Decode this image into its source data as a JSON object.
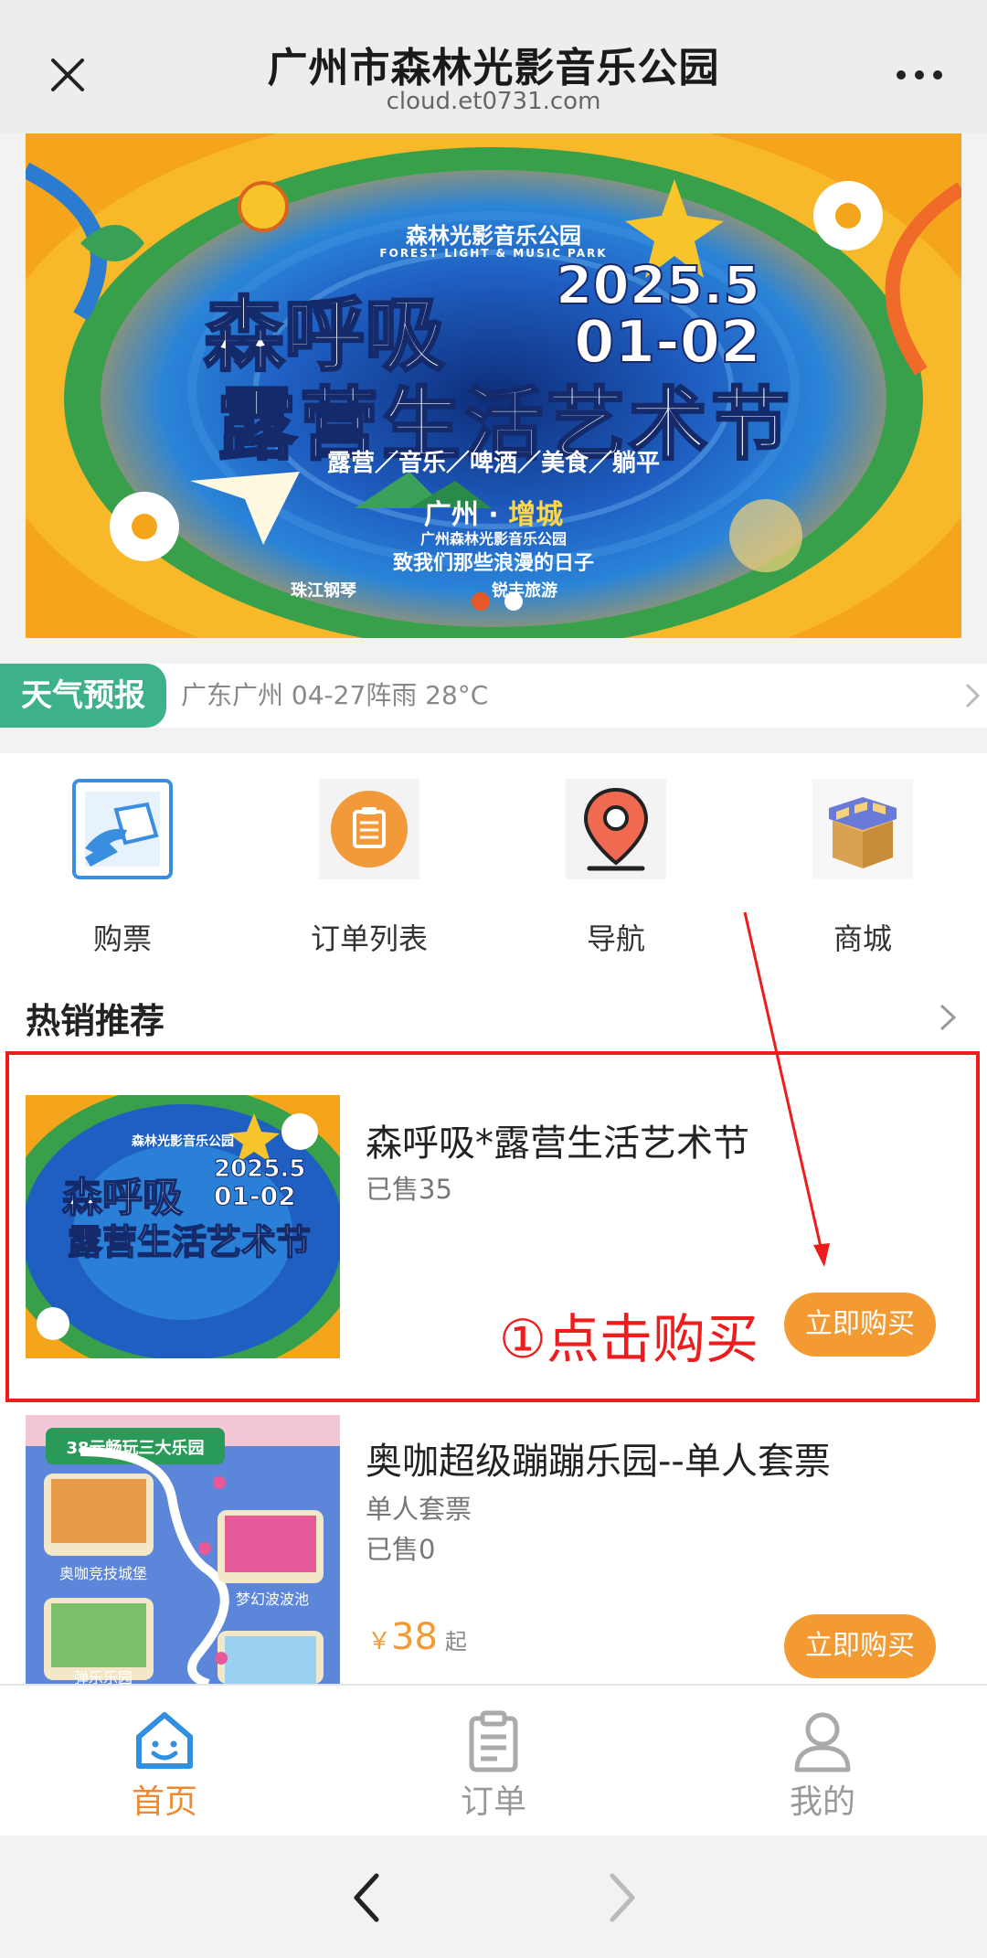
{
  "topbar": {
    "title": "广州市森林光影音乐公园",
    "subtitle": "cloud.et0731.com",
    "close_icon": "close-icon",
    "more_icon": "more-icon"
  },
  "banner": {
    "brand": "森林光影音乐公园",
    "brand_en": "FOREST LIGHT & MUSIC PARK",
    "date_line1": "2025.5",
    "date_line2": "01-02",
    "headline1": "森呼吸",
    "headline2": "露营生活艺术节",
    "tags": "露营／音乐／啤酒／美食／躺平",
    "place_city": "广州 ·",
    "place_district": "增城",
    "place_sub": "广州森林光影音乐公园",
    "motto": "致我们那些浪漫的日子",
    "sponsor1": "珠江钢琴",
    "sponsor2": "锐丰旅游",
    "slide_count": 2,
    "active_slide": 1
  },
  "weather": {
    "tag": "天气预报",
    "info": "广东广州 04-27阵雨 28°C"
  },
  "quicknav": [
    {
      "label": "购票",
      "icon": "ticket-icon"
    },
    {
      "label": "订单列表",
      "icon": "order-list-icon"
    },
    {
      "label": "导航",
      "icon": "location-pin-icon"
    },
    {
      "label": "商城",
      "icon": "shop-icon"
    }
  ],
  "section": {
    "title": "热销推荐"
  },
  "products": [
    {
      "name": "森呼吸*露营生活艺术节",
      "sold": "已售35",
      "buy_label": "立即购买",
      "thumb_headline1": "森呼吸",
      "thumb_headline2": "露营生活艺术节",
      "thumb_date1": "2025.5",
      "thumb_date2": "01-02",
      "thumb_brand": "森林光影音乐公园"
    },
    {
      "name": "奥咖超级蹦蹦乐园--单人套票",
      "type": "单人套票",
      "sold": "已售0",
      "price_symbol": "￥",
      "price": "38",
      "price_suffix": "起",
      "buy_label": "立即购买",
      "thumb_title": "38元畅玩三大乐园",
      "thumb_spot1": "奥咖竞技城堡",
      "thumb_spot2": "梦幻波波池",
      "thumb_spot3": "弹乐乐园"
    }
  ],
  "annotation": {
    "text": "①点击购买",
    "color": "#ee1c1c"
  },
  "tabbar": [
    {
      "label": "首页",
      "icon": "home-icon",
      "active": true
    },
    {
      "label": "订单",
      "icon": "clipboard-icon",
      "active": false
    },
    {
      "label": "我的",
      "icon": "user-icon",
      "active": false
    }
  ],
  "colors": {
    "accent": "#f39a32",
    "weather_tag": "#3db08c",
    "active_tab": "#f08a2e",
    "annotation": "#ee1c1c"
  }
}
